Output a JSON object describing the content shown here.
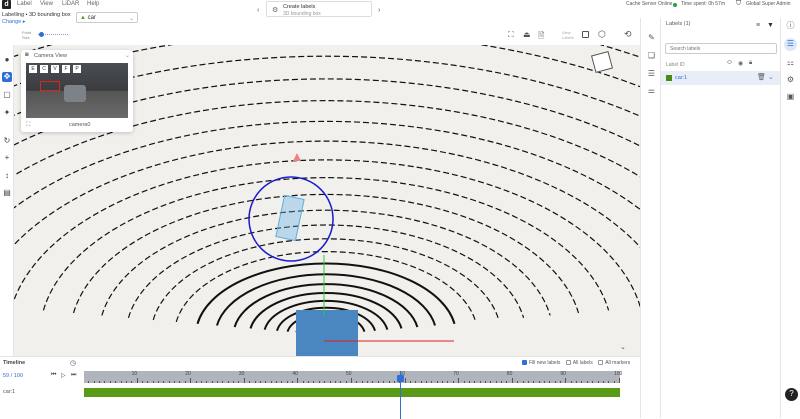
{
  "menu": {
    "logo": "d",
    "items": [
      "Label",
      "View",
      "LiDAR",
      "Help"
    ]
  },
  "header": {
    "breadcrumb": "Labelling • 3D bounding box",
    "change": "Change ▸",
    "class_select": "car",
    "point_size_label": "Point Size",
    "point_size_value": 0.1
  },
  "task": {
    "title": "Create labels",
    "subtitle": "3D bounding box"
  },
  "status": {
    "cache": "Cache Server Online",
    "cache_color": "#2e9e3a",
    "time": "Time spent: 0h 57m",
    "user": "Global Super Admin"
  },
  "toolbar": {
    "view_labels": "View Labels"
  },
  "camera": {
    "title": "Camera View",
    "buttons": [
      "E",
      "C",
      "V",
      "F",
      "P"
    ],
    "name": "camera0"
  },
  "labels_panel": {
    "title": "Labels (1)",
    "search_placeholder": "Search labels",
    "col_header": "Label ID",
    "items": [
      {
        "id": "car:1",
        "color": "#4b8a12"
      }
    ]
  },
  "timeline": {
    "title": "Timeline",
    "frame": "59 / 100",
    "current": 59,
    "total": 100,
    "ticks": [
      "10",
      "20",
      "30",
      "40",
      "50",
      "60",
      "70",
      "80",
      "90",
      "100"
    ],
    "fill_new": "Fill new labels",
    "all_labels": "All labels",
    "all_markers": "All markers",
    "fill_new_checked": true,
    "track_label": "car:1",
    "accent": "#2f6fd6",
    "track_color": "#5a9a17"
  }
}
